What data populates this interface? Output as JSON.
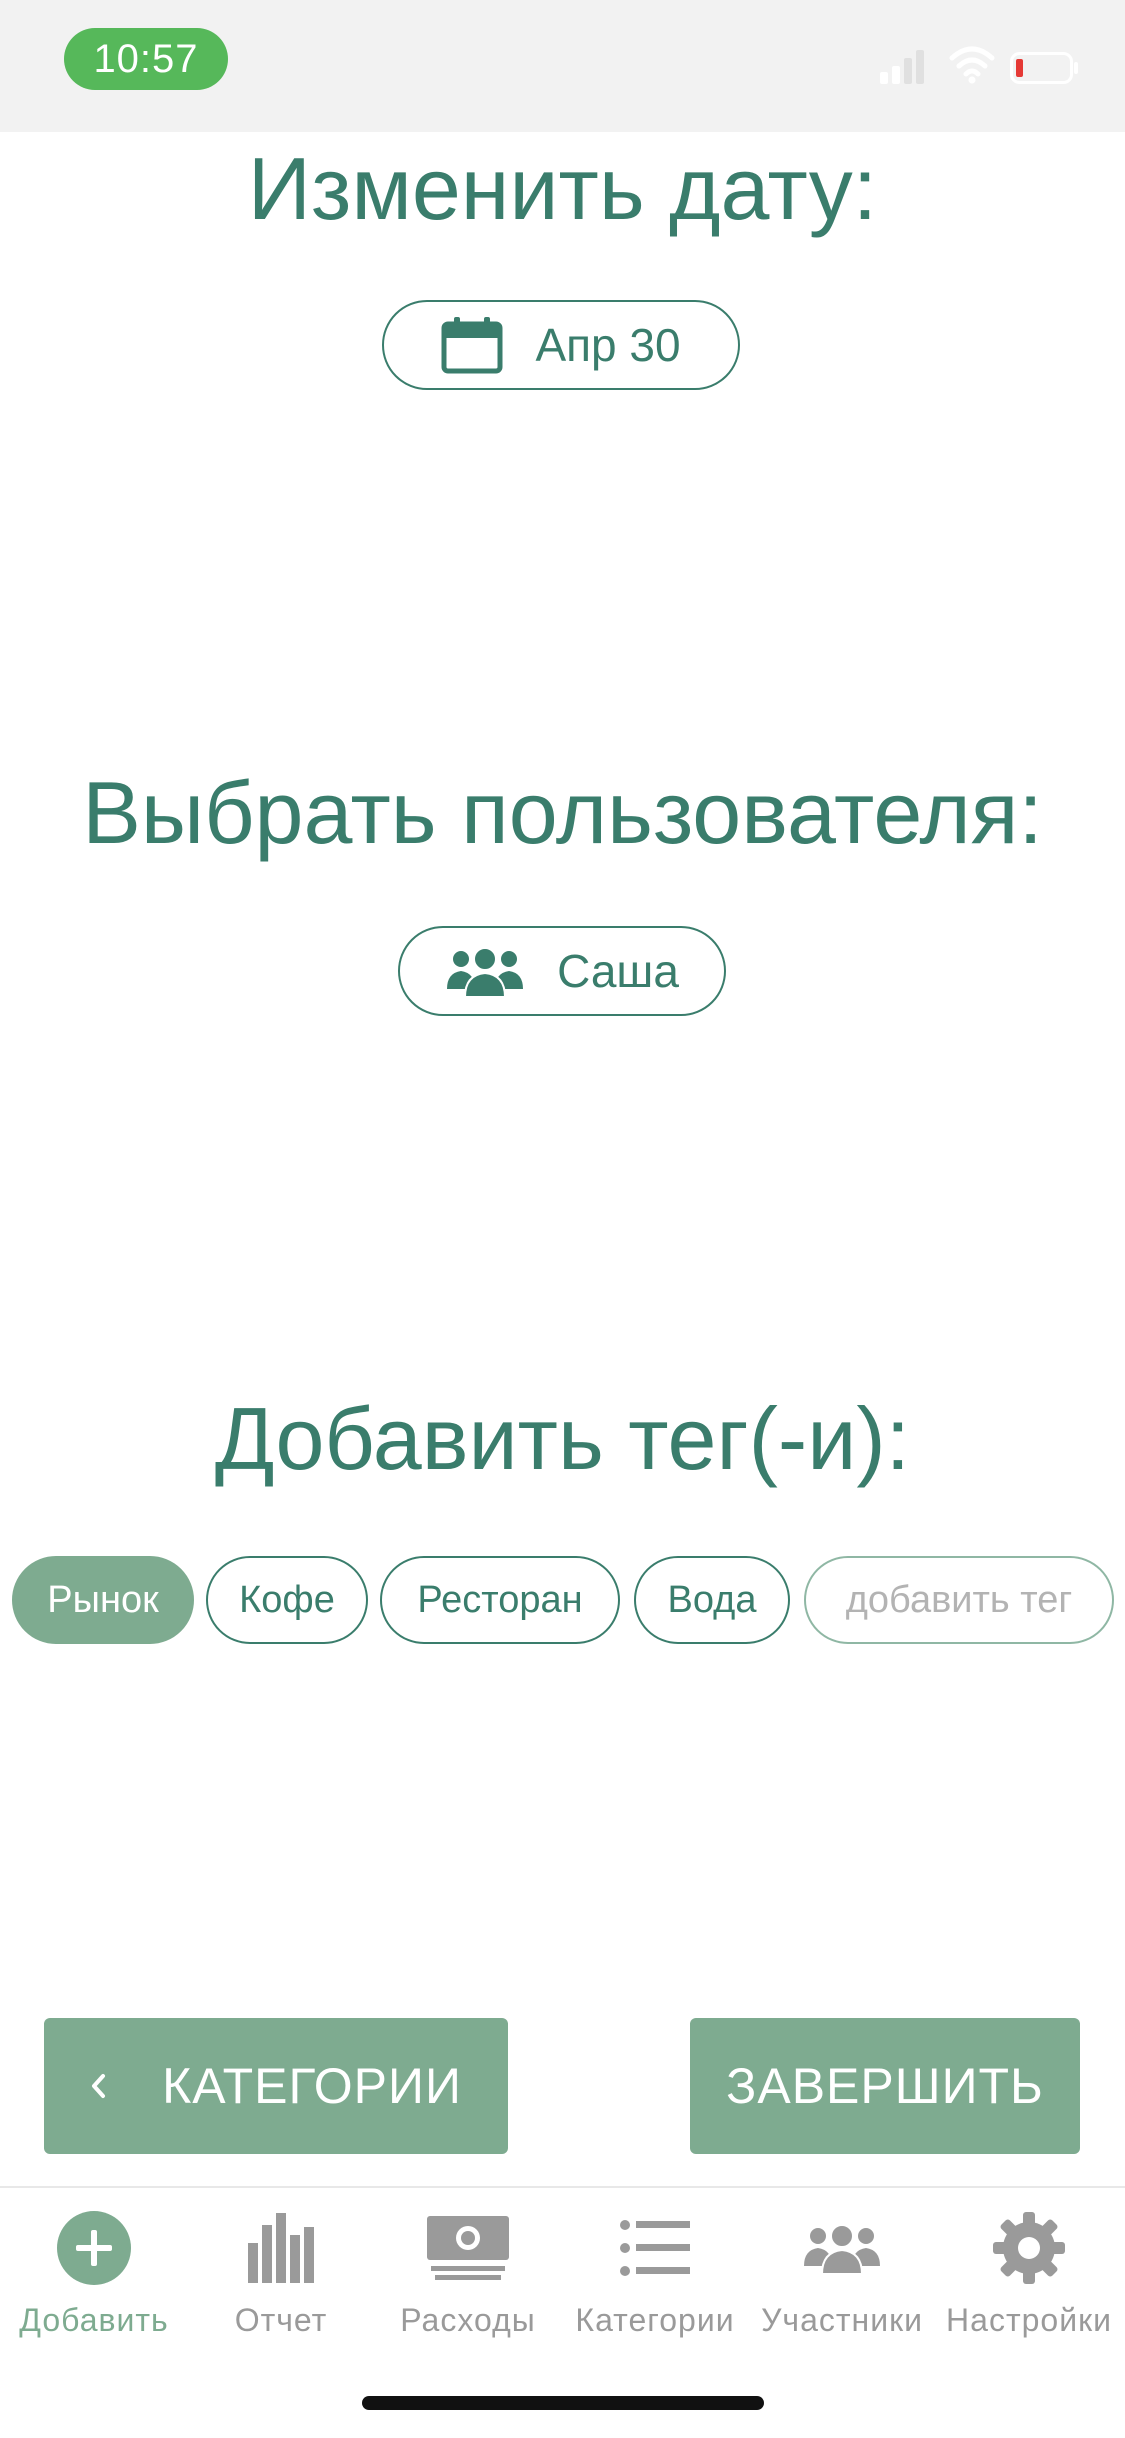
{
  "status_bar": {
    "time": "10:57"
  },
  "date_section": {
    "title": "Изменить дату:",
    "value": "Апр 30",
    "icon": "calendar-icon"
  },
  "user_section": {
    "title": "Выбрать пользователя:",
    "value": "Саша",
    "icon": "users-icon"
  },
  "tags_section": {
    "title": "Добавить тег(-и):",
    "tags": [
      {
        "label": "Рынок",
        "selected": true
      },
      {
        "label": "Кофе",
        "selected": false
      },
      {
        "label": "Ресторан",
        "selected": false
      },
      {
        "label": "Вода",
        "selected": false
      }
    ],
    "add_placeholder": "добавить тег"
  },
  "actions": {
    "back_label": "КАТЕГОРИИ",
    "finish_label": "ЗАВЕРШИТЬ"
  },
  "tab_bar": {
    "tabs": [
      {
        "label": "Добавить",
        "icon": "add-circle-icon",
        "active": true
      },
      {
        "label": "Отчет",
        "icon": "bar-chart-icon",
        "active": false
      },
      {
        "label": "Расходы",
        "icon": "money-icon",
        "active": false
      },
      {
        "label": "Категории",
        "icon": "list-icon",
        "active": false
      },
      {
        "label": "Участники",
        "icon": "users-icon",
        "active": false
      },
      {
        "label": "Настройки",
        "icon": "gear-icon",
        "active": false
      }
    ]
  },
  "colors": {
    "primary": "#3a7d6c",
    "accent": "#7eab90",
    "inactive": "#9a9a9a",
    "status_bar_bg": "#f2f2f2",
    "time_pill": "#56b85a",
    "battery_low": "#e53935"
  }
}
